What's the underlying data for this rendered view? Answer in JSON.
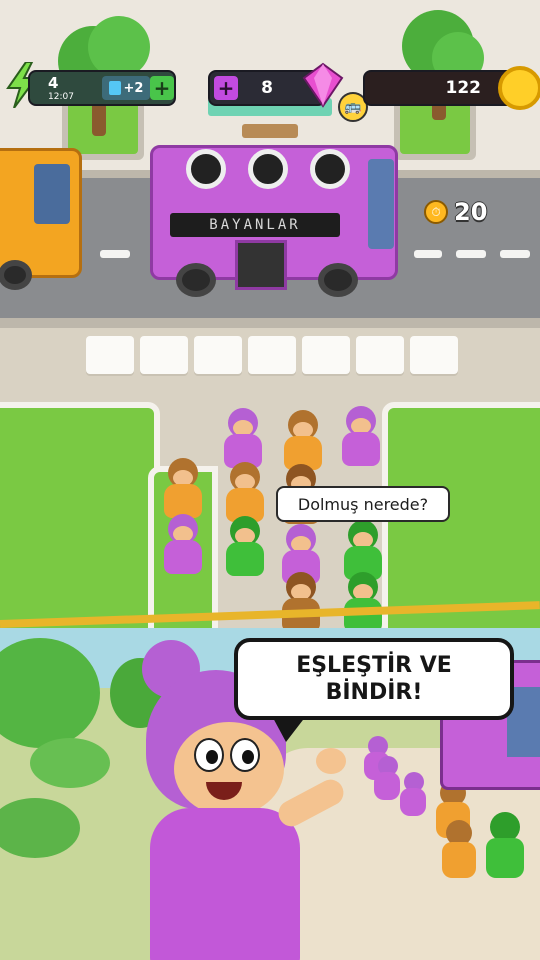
{
  "hud": {
    "energy": {
      "count": "4",
      "timer": "12:07",
      "ticket_bonus": "+2",
      "icon": "lightning-bolt-icon"
    },
    "gems": {
      "count": "8",
      "icon": "pink-gem-icon"
    },
    "coins": {
      "count": "122",
      "icon": "gold-coin-icon"
    }
  },
  "bus": {
    "sign": "BAYANLAR",
    "color": "#c560d8"
  },
  "timer": {
    "value": "20",
    "icon": "stopwatch-icon"
  },
  "slots": {
    "count": 7
  },
  "speech": {
    "small": "Dolmuş nerede?"
  },
  "promo": {
    "headline": "EŞLEŞTİR VE BİNDİR!"
  },
  "colors": {
    "pink": "#c560d8",
    "orange": "#f0a030",
    "green": "#3fbf3a",
    "brown": "#b0722e",
    "grass": "#7ac943",
    "road": "#8a8c8f"
  }
}
